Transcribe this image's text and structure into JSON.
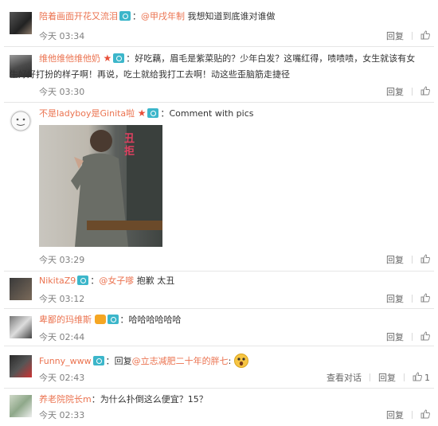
{
  "labels": {
    "reply": "回复",
    "view_conversation": "查看对话"
  },
  "comments": [
    {
      "name": "陪着画面开花又流泪",
      "mention": "@甲戌年制",
      "text": " 我想知道到底谁对谁做",
      "time": "今天 03:34"
    },
    {
      "name": "维他维他维他奶",
      "text_line1": "：好吃藕，眉毛是紫菜贴的？少年白发？这嘴红得，啧啧啧，女生就该有女",
      "text_line2": "生好好打扮的样子啊！再说，吃土就给我打工去啊！动这些歪脑筋走捷径",
      "time": "今天 03:30"
    },
    {
      "name": "不是ladyboy是Ginita啦",
      "text": "：Comment with pics",
      "image_caption": "丑拒",
      "time": "今天 03:29"
    },
    {
      "name": "NikitaZ9",
      "mention": "@女子嗲",
      "text": " 抱歉 太丑",
      "time": "今天 03:12"
    },
    {
      "name": "卑鄙的玛维斯",
      "text": "：哈哈哈哈哈哈",
      "time": "今天 02:44"
    },
    {
      "name": "Funny_www",
      "text_prefix": "：回复",
      "mention": "@立志减肥二十年的胖七",
      "text": ":",
      "time": "今天 02:43",
      "likes": "1"
    },
    {
      "name": "养老院院长m",
      "text": "：为什么扑倒这么便宜？15？",
      "time": "今天 02:33"
    }
  ],
  "colors": {
    "name": "#eb7350",
    "time": "#808080",
    "badge": "#3cb6ca",
    "star": "#e8503a"
  }
}
